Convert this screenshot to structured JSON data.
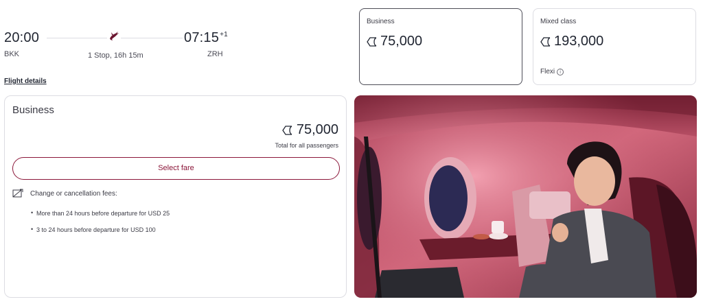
{
  "flight": {
    "departure_time": "20:00",
    "departure_code": "BKK",
    "arrival_time": "07:15",
    "arrival_day_offset": "+1",
    "arrival_code": "ZRH",
    "stops": "1 Stop, 16h 15m",
    "details_link": "Flight details",
    "logo_icon": "oryx-logo-icon"
  },
  "fare_cards": [
    {
      "label": "Business",
      "price": "75,000",
      "selected": true,
      "sub": ""
    },
    {
      "label": "Mixed class",
      "price": "193,000",
      "selected": false,
      "sub": "Flexi"
    }
  ],
  "detail": {
    "title": "Business",
    "price": "75,000",
    "total_note": "Total for all passengers",
    "select_button": "Select fare",
    "fees_heading": "Change or cancellation fees:",
    "fees": [
      "More than 24 hours before departure for USD 25",
      "3 to 24 hours before departure for USD 100"
    ]
  },
  "colors": {
    "brand": "#8a1538",
    "border": "#dcdce2",
    "text": "#1f2430"
  },
  "image": {
    "alt": "business-class-cabin-photo"
  }
}
